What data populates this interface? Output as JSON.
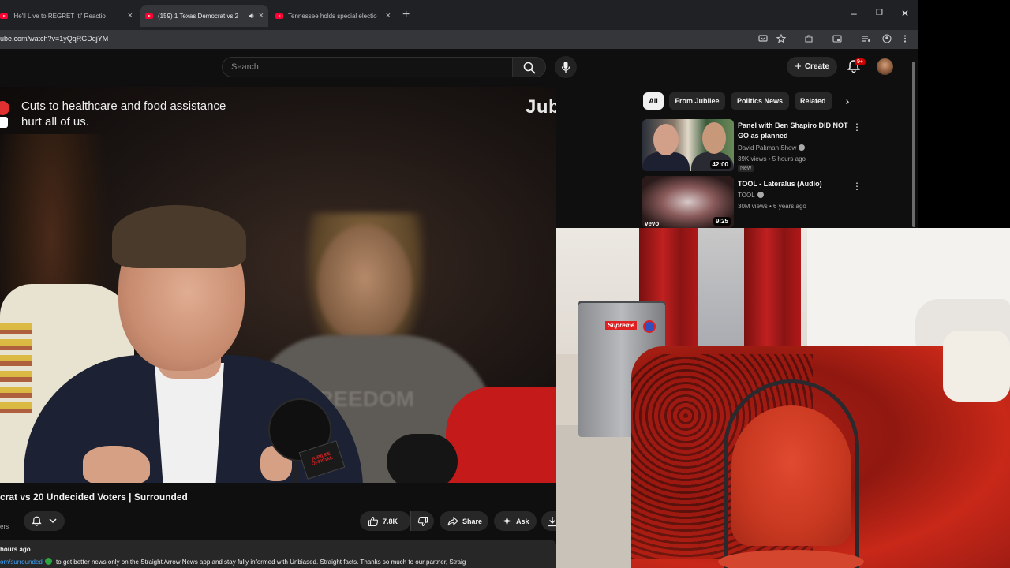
{
  "browser": {
    "tabs": [
      {
        "title": "'He'll Live to REGRET It!' Reactio",
        "active": false,
        "audio": false
      },
      {
        "title": "(159) 1 Texas Democrat vs 2",
        "active": true,
        "audio": true
      },
      {
        "title": "Tennessee holds special electio",
        "active": false,
        "audio": false
      }
    ],
    "new_tab": "+",
    "window_controls": {
      "minimize": "–",
      "maximize": "❐",
      "close": "✕"
    },
    "url": "ube.com/watch?v=1yQqRGDqjYM"
  },
  "youtube": {
    "search_placeholder": "Search",
    "create_label": "Create",
    "notification_count": "9+"
  },
  "video": {
    "overlay_text_line1": "Cuts to healthcare and food assistance",
    "overlay_text_line2": "hurt all of us.",
    "brand": "Jubilee",
    "background_word": "FREEDOM",
    "mic_flag": "JUBILEE OFFICIAL"
  },
  "video_info": {
    "title": "crat vs 20 Undecided Voters | Surrounded",
    "subscribers": "ers",
    "likes": "7.8K",
    "share_label": "Share",
    "ask_label": "Ask",
    "age": "hours ago",
    "desc_link": "om/surrounded",
    "desc_text": "to get better news only on the Straight Arrow News app and stay fully informed with Unbiased. Straight facts. Thanks so much to our partner, Straig"
  },
  "chips": [
    {
      "label": "All",
      "selected": true
    },
    {
      "label": "From Jubilee",
      "selected": false
    },
    {
      "label": "Politics News",
      "selected": false
    },
    {
      "label": "Related",
      "selected": false
    }
  ],
  "recommendations": [
    {
      "title": "Panel with Ben Shapiro DID NOT GO as planned",
      "channel": "David Pakman Show",
      "meta": "39K views • 5 hours ago",
      "badge": "New",
      "duration": "42:00"
    },
    {
      "title": "TOOL - Lateralus (Audio)",
      "channel": "TOOL",
      "meta": "30M views • 6 years ago",
      "duration": "9:25",
      "label": "vevo"
    }
  ],
  "webcam": {
    "fridge_brand": "Supreme"
  },
  "colors": {
    "youtube_red": "#ff0033",
    "background": "#0f0f0f",
    "chip_bg": "#272727",
    "link": "#3ea6ff"
  }
}
